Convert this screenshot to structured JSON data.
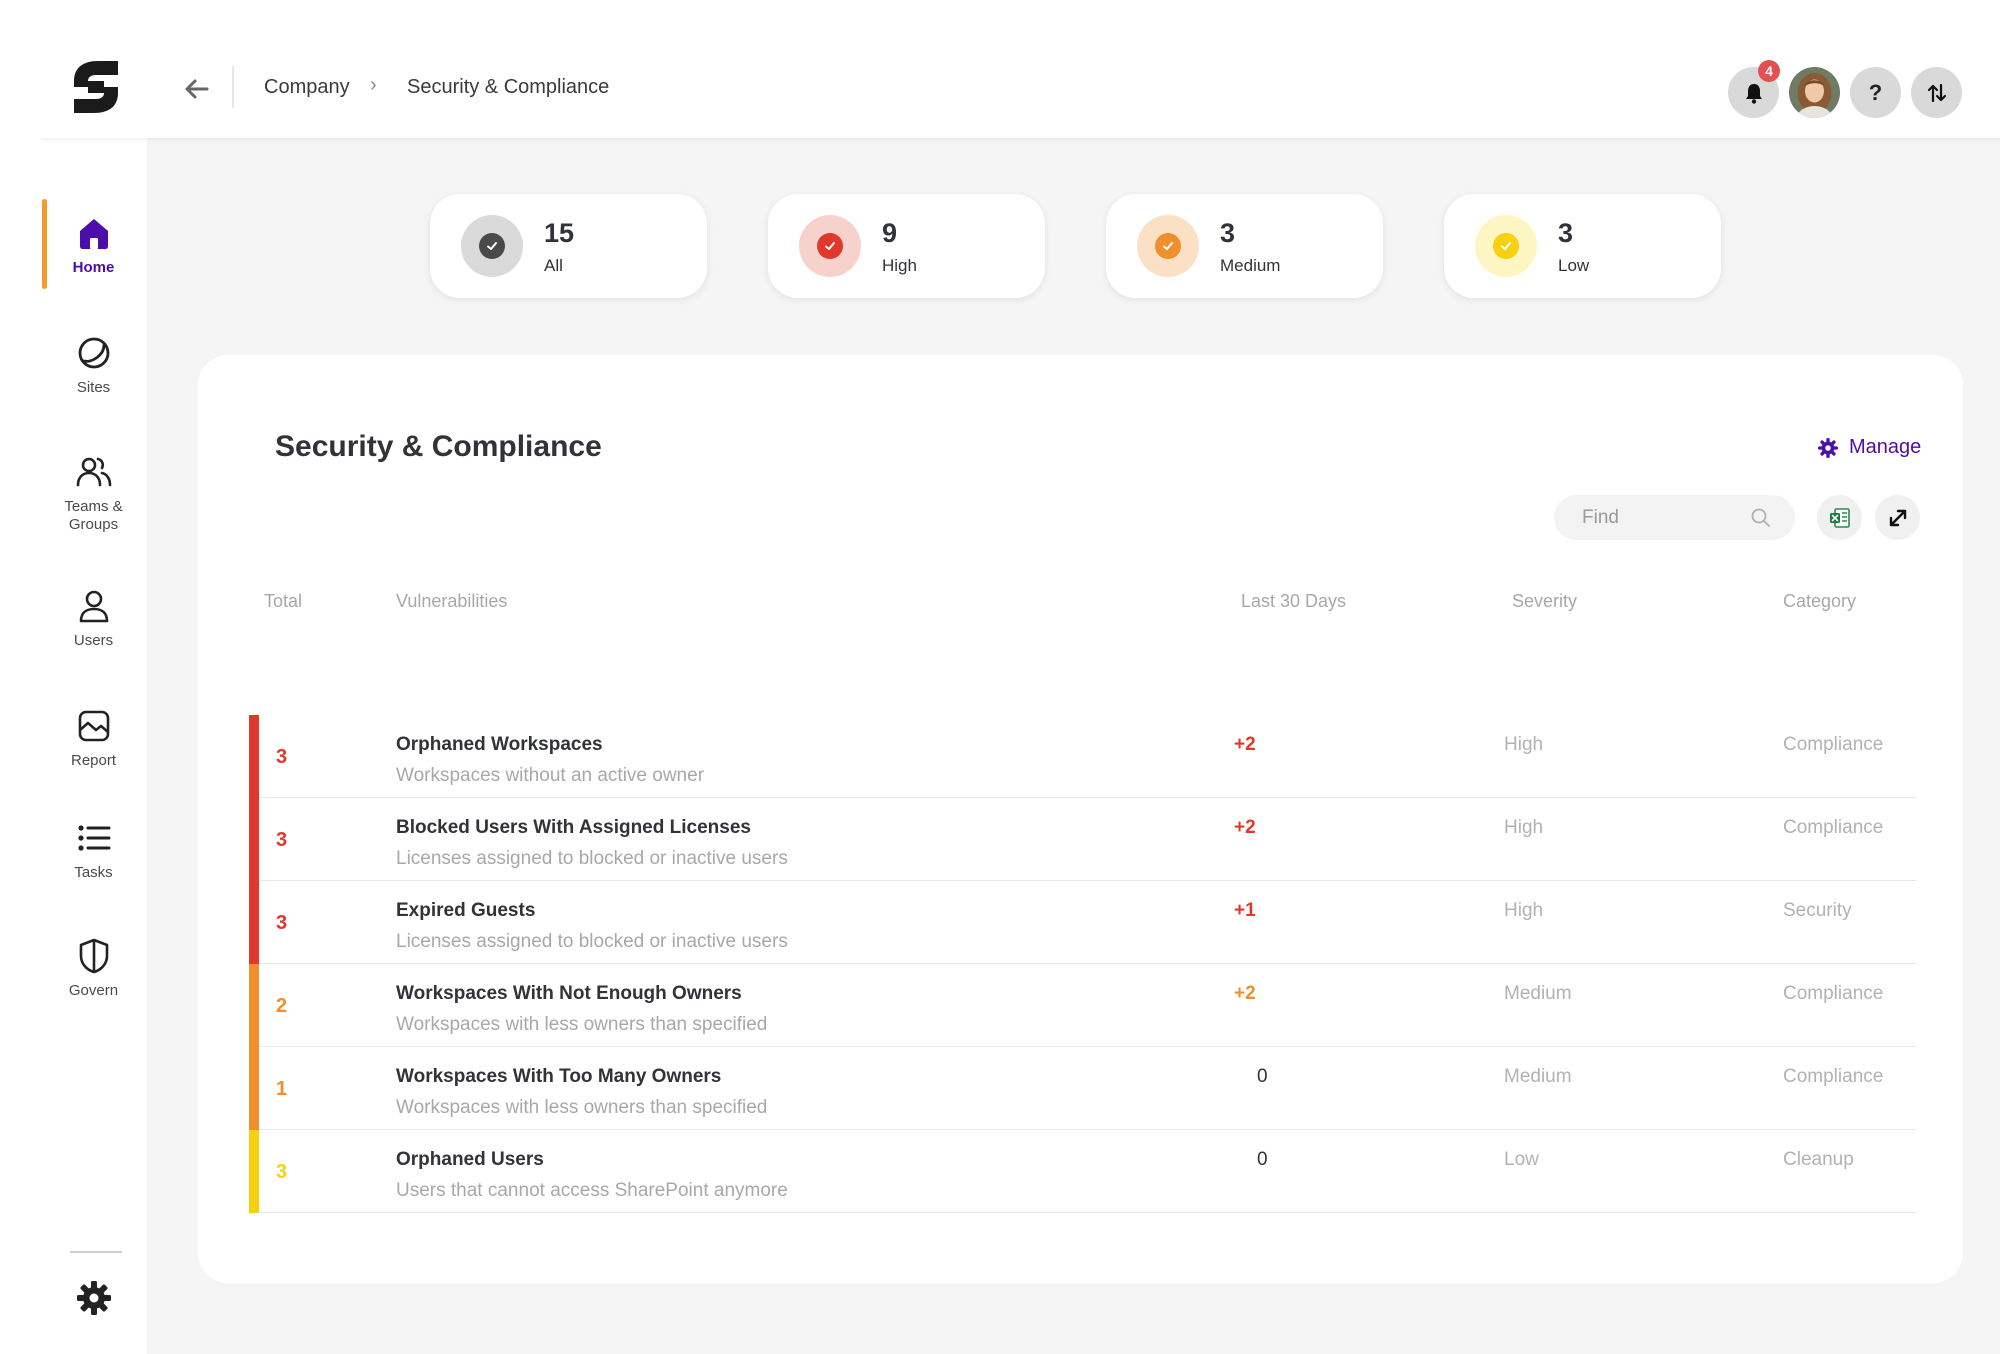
{
  "header": {
    "breadcrumb": {
      "company": "Company",
      "separator": "›",
      "current": "Security & Compliance"
    },
    "notification_count": "4",
    "help_label": "?"
  },
  "sidebar": {
    "items": [
      {
        "label": "Home",
        "icon": "home-icon",
        "active": true
      },
      {
        "label": "Sites",
        "icon": "sites-icon"
      },
      {
        "label": "Teams &",
        "label2": "Groups",
        "icon": "teams-groups-icon"
      },
      {
        "label": "Users",
        "icon": "user-icon"
      },
      {
        "label": "Report",
        "icon": "report-icon"
      },
      {
        "label": "Tasks",
        "icon": "tasks-icon"
      },
      {
        "label": "Govern",
        "icon": "shield-icon"
      }
    ]
  },
  "summary": [
    {
      "count": "15",
      "label": "All",
      "ring": "#dadada",
      "dot": "#4a4a4a"
    },
    {
      "count": "9",
      "label": "High",
      "ring": "#f7d2cc",
      "dot": "#e0382b"
    },
    {
      "count": "3",
      "label": "Medium",
      "ring": "#fbe0c6",
      "dot": "#f18f2c"
    },
    {
      "count": "3",
      "label": "Low",
      "ring": "#fdf5c2",
      "dot": "#f5d10f"
    }
  ],
  "panel": {
    "title": "Security & Compliance",
    "manage_label": "Manage",
    "find_placeholder": "Find"
  },
  "table": {
    "columns": {
      "total": "Total",
      "vulnerabilities": "Vulnerabilities",
      "last30": "Last 30 Days",
      "severity": "Severity",
      "category": "Category"
    },
    "rows": [
      {
        "total": "3",
        "name": "Orphaned Workspaces",
        "desc": "Workspaces without an active owner",
        "last30": "+2",
        "severity": "High",
        "category": "Compliance"
      },
      {
        "total": "3",
        "name": "Blocked Users With Assigned Licenses",
        "desc": "Licenses assigned to blocked or inactive users",
        "last30": "+2",
        "severity": "High",
        "category": "Compliance"
      },
      {
        "total": "3",
        "name": "Expired Guests",
        "desc": "Licenses assigned to blocked or inactive users",
        "last30": "+1",
        "severity": "High",
        "category": "Security"
      },
      {
        "total": "2",
        "name": "Workspaces With Not Enough Owners",
        "desc": "Workspaces with less owners than specified",
        "last30": "+2",
        "severity": "Medium",
        "category": "Compliance"
      },
      {
        "total": "1",
        "name": "Workspaces With Too Many Owners",
        "desc": "Workspaces with less owners than specified",
        "last30": "0",
        "severity": "Medium",
        "category": "Compliance"
      },
      {
        "total": "3",
        "name": "Orphaned Users",
        "desc": "Users that cannot access SharePoint anymore",
        "last30": "0",
        "severity": "Low",
        "category": "Cleanup"
      }
    ]
  },
  "colors": {
    "accent": "#4b0ea8",
    "active_bar": "#f39a2b",
    "high": "#e0382b",
    "medium": "#f18f2c",
    "low": "#f5d10f"
  }
}
